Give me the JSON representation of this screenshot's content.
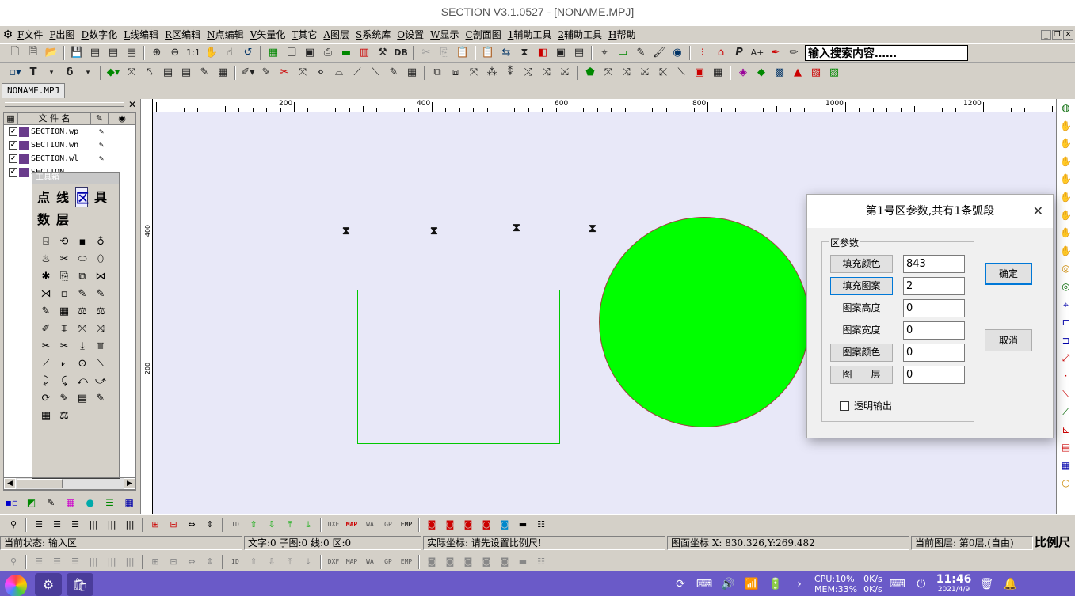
{
  "window": {
    "title": "SECTION V3.1.0527 - [NONAME.MPJ]"
  },
  "menu": {
    "items": [
      {
        "key": "F",
        "label": "文件"
      },
      {
        "key": "P",
        "label": "出图"
      },
      {
        "key": "D",
        "label": "数字化"
      },
      {
        "key": "L",
        "label": "线编辑"
      },
      {
        "key": "R",
        "label": "区编辑"
      },
      {
        "key": "N",
        "label": "点编辑"
      },
      {
        "key": "V",
        "label": "矢量化"
      },
      {
        "key": "T",
        "label": "其它"
      },
      {
        "key": "A",
        "label": "图层"
      },
      {
        "key": "S",
        "label": "系统库"
      },
      {
        "key": "O",
        "label": "设置"
      },
      {
        "key": "W",
        "label": "显示"
      },
      {
        "key": "C",
        "label": "剖面图"
      },
      {
        "key": "1",
        "label": "辅助工具"
      },
      {
        "key": "2",
        "label": "辅助工具"
      },
      {
        "key": "H",
        "label": "帮助"
      }
    ]
  },
  "toolbar1": {
    "zoom_ratio": "1:1",
    "db_label": "DB",
    "p_label": "P",
    "aplus_label": "A+"
  },
  "search": {
    "value": "输入搜索内容……"
  },
  "toolbar2": {
    "t_label": "T",
    "delta_label": "δ"
  },
  "document_tab": {
    "label": "NONAME.MPJ"
  },
  "file_panel": {
    "header": {
      "name_col": "文 件 名"
    },
    "files": [
      {
        "name": "SECTION.wp"
      },
      {
        "name": "SECTION.wn"
      },
      {
        "name": "SECTION.wl"
      },
      {
        "name": "SECTION..."
      }
    ]
  },
  "toolbox": {
    "title": "工具箱",
    "categories": [
      "点",
      "线",
      "区",
      "具",
      "数",
      "层"
    ],
    "selected_category": "区"
  },
  "ruler": {
    "h_labels": [
      "200",
      "400",
      "600",
      "800",
      "1000",
      "1200"
    ],
    "v_labels": [
      "400",
      "200"
    ]
  },
  "bottom_toolbar": {
    "id": "ID",
    "dxf": "DXF",
    "map": "MAP",
    "wa": "WA",
    "gp": "GP",
    "emp": "EMP"
  },
  "status": {
    "state": "当前状态: 输入区",
    "counts": "文字:0 子图:0 线:0 区:0",
    "actual_coords": "实际坐标: 请先设置比例尺!",
    "map_coords": "图面坐标 X: 830.326,Y:269.482",
    "layer": "当前图层: 第0层,(自由)",
    "scale": "比例尺"
  },
  "dialog": {
    "title": "第1号区参数,共有1条弧段",
    "group_label": "区参数",
    "fields": [
      {
        "label": "填充颜色",
        "value": "843",
        "button": true
      },
      {
        "label": "填充图案",
        "value": "2",
        "button": true
      },
      {
        "label": "图案高度",
        "value": "0",
        "button": false
      },
      {
        "label": "图案宽度",
        "value": "0",
        "button": false
      },
      {
        "label": "图案颜色",
        "value": "0",
        "button": true
      },
      {
        "label": "图　　层",
        "value": "0",
        "button": true
      }
    ],
    "transparent_label": "透明输出",
    "ok_label": "确定",
    "cancel_label": "取消"
  },
  "taskbar": {
    "cpu": "CPU:10%",
    "mem": "MEM:33%",
    "net_up": "0K/s",
    "net_down": "0K/s",
    "time": "11:46",
    "date": "2021/4/9"
  },
  "colors": {
    "fill_green": "#00ff00",
    "outline_green": "#00c800",
    "canvas_bg": "#e8e8f8",
    "taskbar": "#6a5ac8"
  }
}
